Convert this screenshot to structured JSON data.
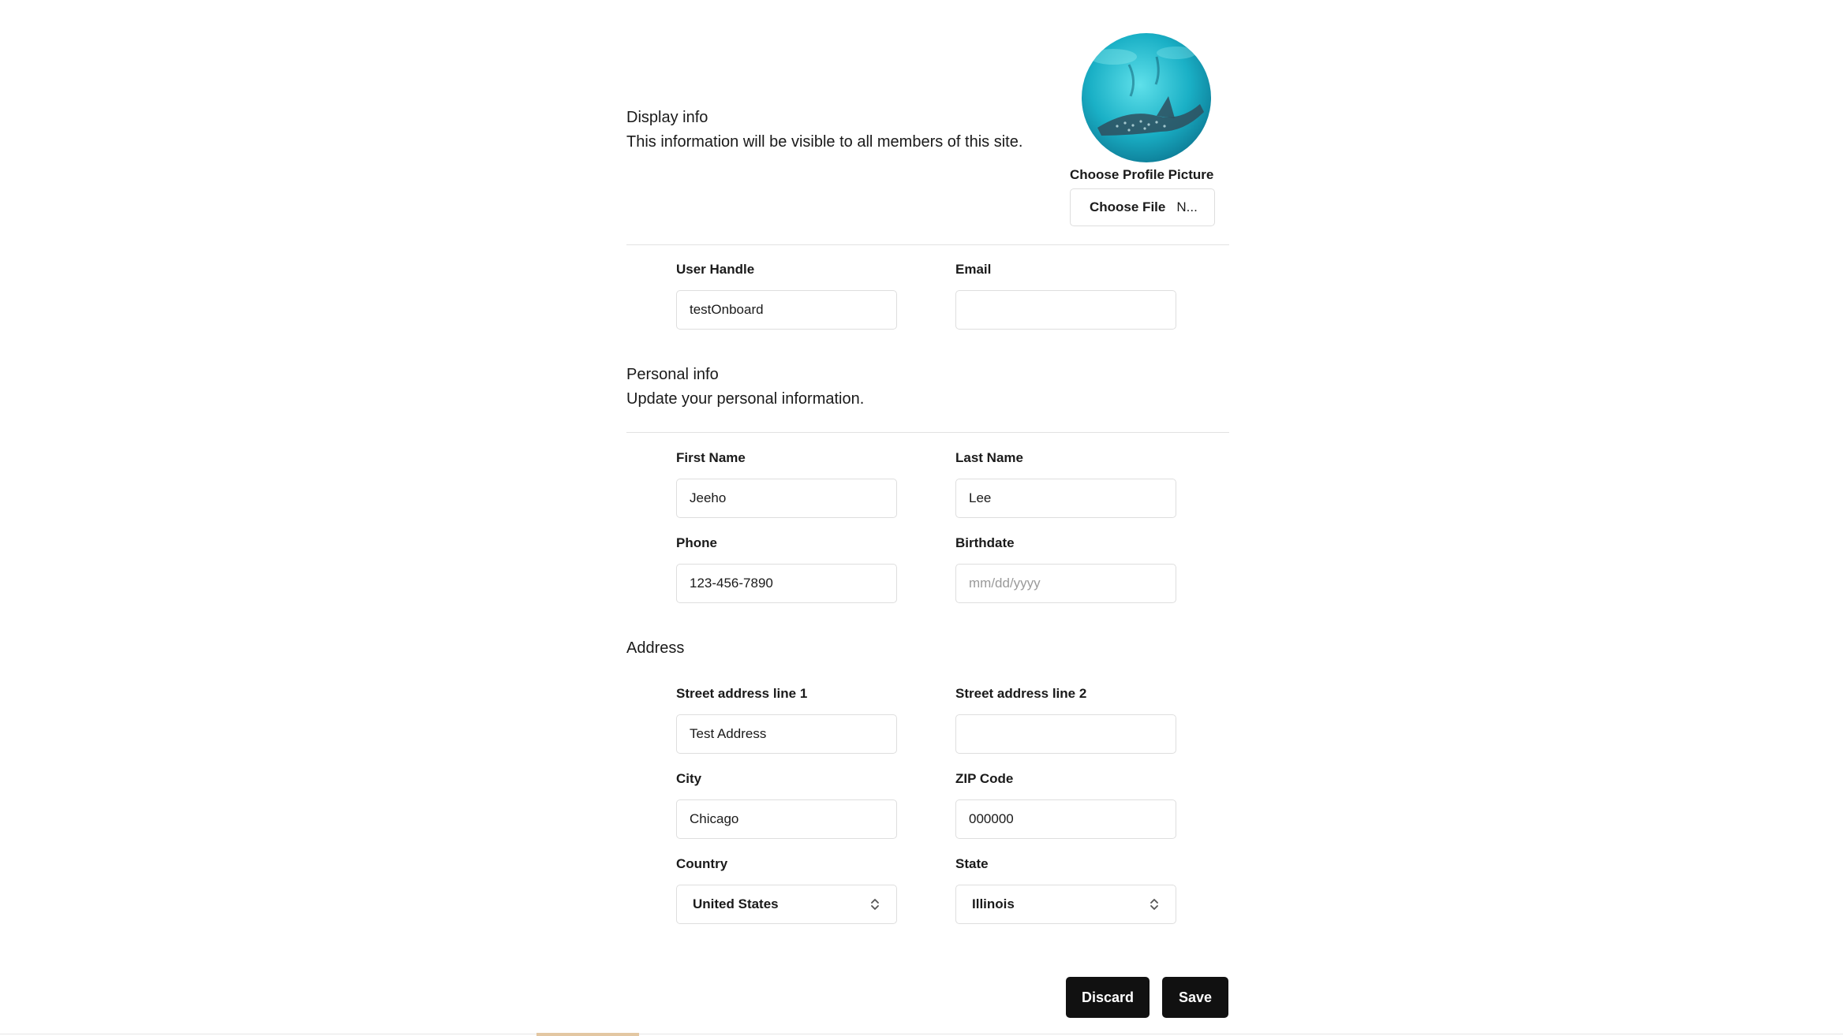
{
  "display_info": {
    "title": "Display info",
    "description": "This information will be visible to all members of this site.",
    "choose_picture_label": "Choose Profile Picture",
    "file_button_label": "Choose File",
    "file_status": "N..."
  },
  "account": {
    "user_handle": {
      "label": "User Handle",
      "value": "testOnboard"
    },
    "email": {
      "label": "Email",
      "value": ""
    }
  },
  "personal_info": {
    "title": "Personal info",
    "description": "Update your personal information.",
    "first_name": {
      "label": "First Name",
      "value": "Jeeho"
    },
    "last_name": {
      "label": "Last Name",
      "value": "Lee"
    },
    "phone": {
      "label": "Phone",
      "value": "123-456-7890"
    },
    "birthdate": {
      "label": "Birthdate",
      "value": "",
      "placeholder": "mm/dd/yyyy"
    }
  },
  "address": {
    "title": "Address",
    "street1": {
      "label": "Street address line 1",
      "value": "Test Address"
    },
    "street2": {
      "label": "Street address line 2",
      "value": ""
    },
    "city": {
      "label": "City",
      "value": "Chicago"
    },
    "zip": {
      "label": "ZIP Code",
      "value": "000000"
    },
    "country": {
      "label": "Country",
      "value": "United States"
    },
    "state": {
      "label": "State",
      "value": "Illinois"
    }
  },
  "actions": {
    "discard_label": "Discard",
    "save_label": "Save"
  },
  "icons": {
    "select_arrow": "chevron-up-down-icon",
    "avatar": "whale-shark-photo"
  },
  "colors": {
    "button_dark": "#111111",
    "border": "#dedede",
    "avatar_water": "#1fb3c9"
  }
}
